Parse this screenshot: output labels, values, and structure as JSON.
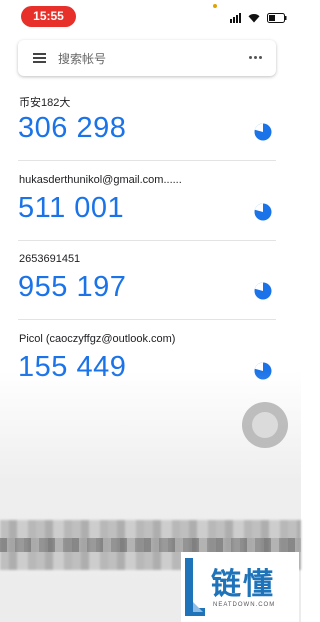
{
  "status_bar": {
    "time": "15:55",
    "icons": [
      "signal-icon",
      "wifi-icon",
      "battery-icon"
    ]
  },
  "search": {
    "placeholder": "搜索帐号",
    "menu_icon": "menu-icon",
    "more_icon": "more-vert-icon"
  },
  "accounts": [
    {
      "name": "币安182大",
      "code": "306 298",
      "timer_icon": "countdown-timer-icon"
    },
    {
      "name": "hukasderthunikol@gmail.com......",
      "code": "511 001",
      "timer_icon": "countdown-timer-icon"
    },
    {
      "name": "2653691451",
      "code": "955 197",
      "timer_icon": "countdown-timer-icon"
    },
    {
      "name": "Picol (caoczyffgz@outlook.com)",
      "code": "155 449",
      "timer_icon": "countdown-timer-icon"
    }
  ],
  "colors": {
    "accent": "#1a73e8",
    "time_pill": "#e8302a",
    "watermark": "#1e73b9"
  },
  "watermark": {
    "text": "链懂",
    "subtext": "NEATDOWN.COM"
  }
}
